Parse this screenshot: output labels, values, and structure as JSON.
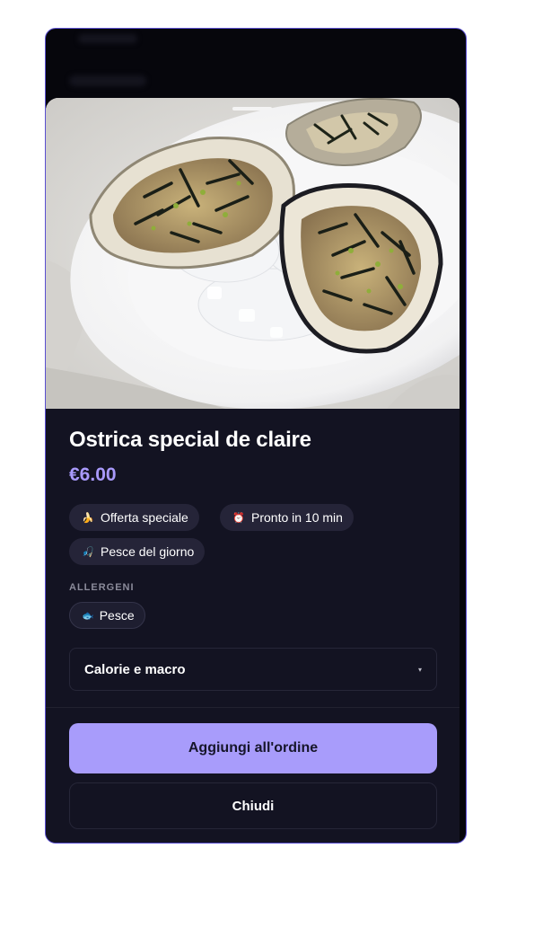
{
  "product": {
    "name": "Ostrica special de claire",
    "price": "€6.00",
    "image_alt": "oysters-on-plate"
  },
  "tags": [
    {
      "icon": "banana-icon",
      "glyph": "🍌",
      "label": "Offerta speciale"
    },
    {
      "icon": "timer-icon",
      "glyph": "⏰",
      "label": "Pronto in 10 min"
    },
    {
      "icon": "fish-hook-icon",
      "glyph": "🎣",
      "label": "Pesce del giorno"
    }
  ],
  "allergens": {
    "title": "ALLERGENI",
    "items": [
      {
        "icon": "fish-icon",
        "glyph": "🐟",
        "label": "Pesce"
      }
    ]
  },
  "nutrition": {
    "label": "Calorie e macro",
    "chevron": "▾"
  },
  "actions": {
    "add_label": "Aggiungi all'ordine",
    "close_label": "Chiudi"
  },
  "colors": {
    "accent": "#a89cfb",
    "price": "#a99afc",
    "sheet_bg": "#131322",
    "chip_bg": "#252438"
  }
}
